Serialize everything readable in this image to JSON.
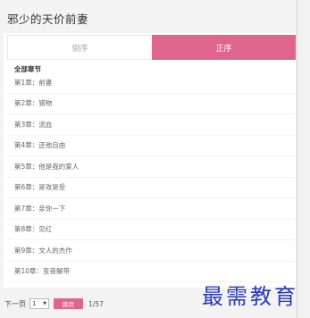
{
  "title": "邪少的天价前妻",
  "tabs": {
    "reverse": "倒序",
    "forward": "正序"
  },
  "section_heading": "全部章节",
  "chapters": [
    "第1章：前妻",
    "第2章：猎物",
    "第3章：流血",
    "第4章：还他自由",
    "第5章：他是我的爱人",
    "第6章：是攻是受",
    "第7章：亲你一下",
    "第8章：见红",
    "第9章：文人的杰作",
    "第10章：变夜解带"
  ],
  "pager": {
    "next": "下一页",
    "select_value": "1",
    "jump": "跳页",
    "pages": "1/57"
  },
  "watermark": "最需教育",
  "colors": {
    "accent": "#e0658d",
    "watermark": "#2a3bb8"
  }
}
